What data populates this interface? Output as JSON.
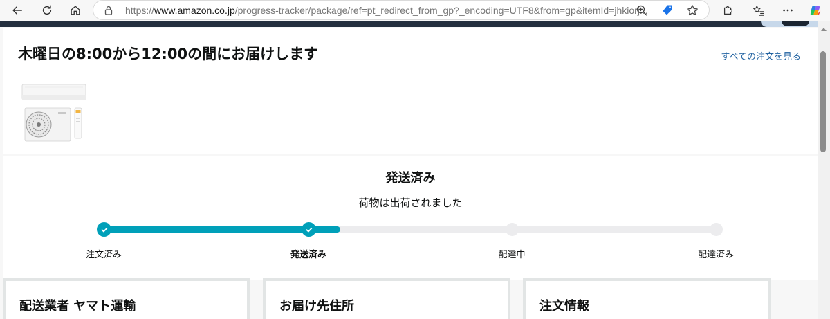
{
  "browser": {
    "url_prefix": "https://",
    "url_domain": "www.amazon.co.jp",
    "url_path": "/progress-tracker/package/ref=pt_redirect_from_gp?_encoding=UTF8&from=gp&itemId=jhkiorj..."
  },
  "header": {
    "delivery_estimate": "木曜日の8:00から12:00の間にお届けします",
    "all_orders_link": "すべての注文を見る"
  },
  "status": {
    "title": "発送済み",
    "subtitle": "荷物は出荷されました"
  },
  "tracker": {
    "steps": [
      {
        "label": "注文済み",
        "state": "done"
      },
      {
        "label": "発送済み",
        "state": "current"
      },
      {
        "label": "配達中",
        "state": "pending"
      },
      {
        "label": "配達済み",
        "state": "pending"
      }
    ],
    "progress_fraction": 0.33
  },
  "cards": {
    "carrier_title": "配送業者 ヤマト運輸",
    "address_title": "お届け先住所",
    "order_info_title": "注文情報"
  },
  "colors": {
    "progress_accent": "#00a0b9",
    "link": "#2162a1",
    "topbar": "#232f3e"
  }
}
